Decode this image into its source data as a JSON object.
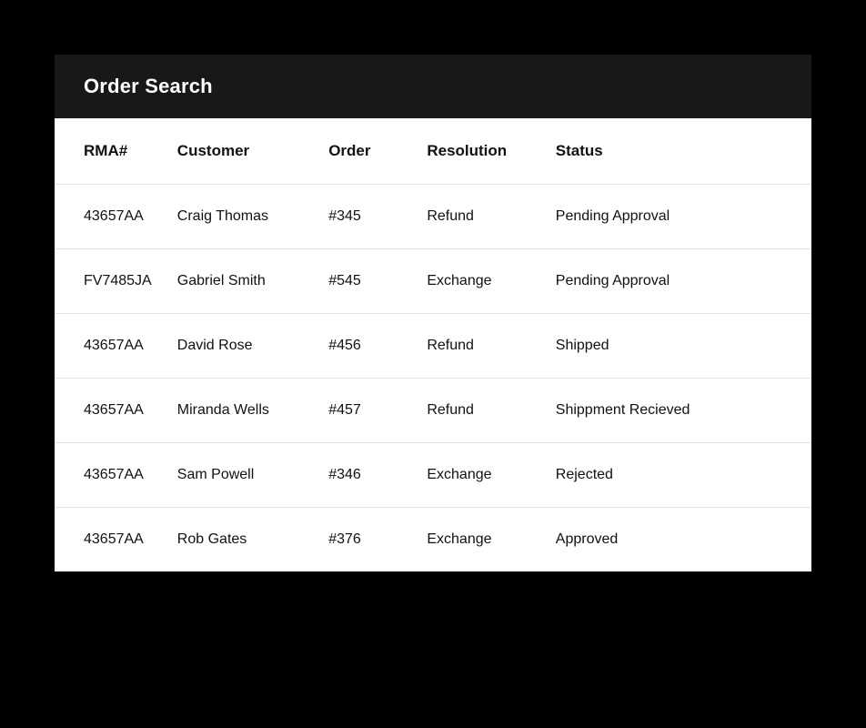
{
  "header": {
    "title": "Order Search"
  },
  "table": {
    "columns": {
      "rma": "RMA#",
      "customer": "Customer",
      "order": "Order",
      "resolution": "Resolution",
      "status": "Status"
    },
    "rows": [
      {
        "rma": "43657AA",
        "customer": "Craig Thomas",
        "order": "#345",
        "resolution": "Refund",
        "status": "Pending Approval"
      },
      {
        "rma": "FV7485JA",
        "customer": "Gabriel Smith",
        "order": "#545",
        "resolution": "Exchange",
        "status": "Pending Approval"
      },
      {
        "rma": "43657AA",
        "customer": "David Rose",
        "order": "#456",
        "resolution": "Refund",
        "status": "Shipped"
      },
      {
        "rma": "43657AA",
        "customer": "Miranda Wells",
        "order": "#457",
        "resolution": "Refund",
        "status": "Shippment Recieved"
      },
      {
        "rma": "43657AA",
        "customer": "Sam Powell",
        "order": "#346",
        "resolution": "Exchange",
        "status": "Rejected"
      },
      {
        "rma": "43657AA",
        "customer": "Rob Gates",
        "order": "#376",
        "resolution": "Exchange",
        "status": "Approved"
      }
    ]
  }
}
